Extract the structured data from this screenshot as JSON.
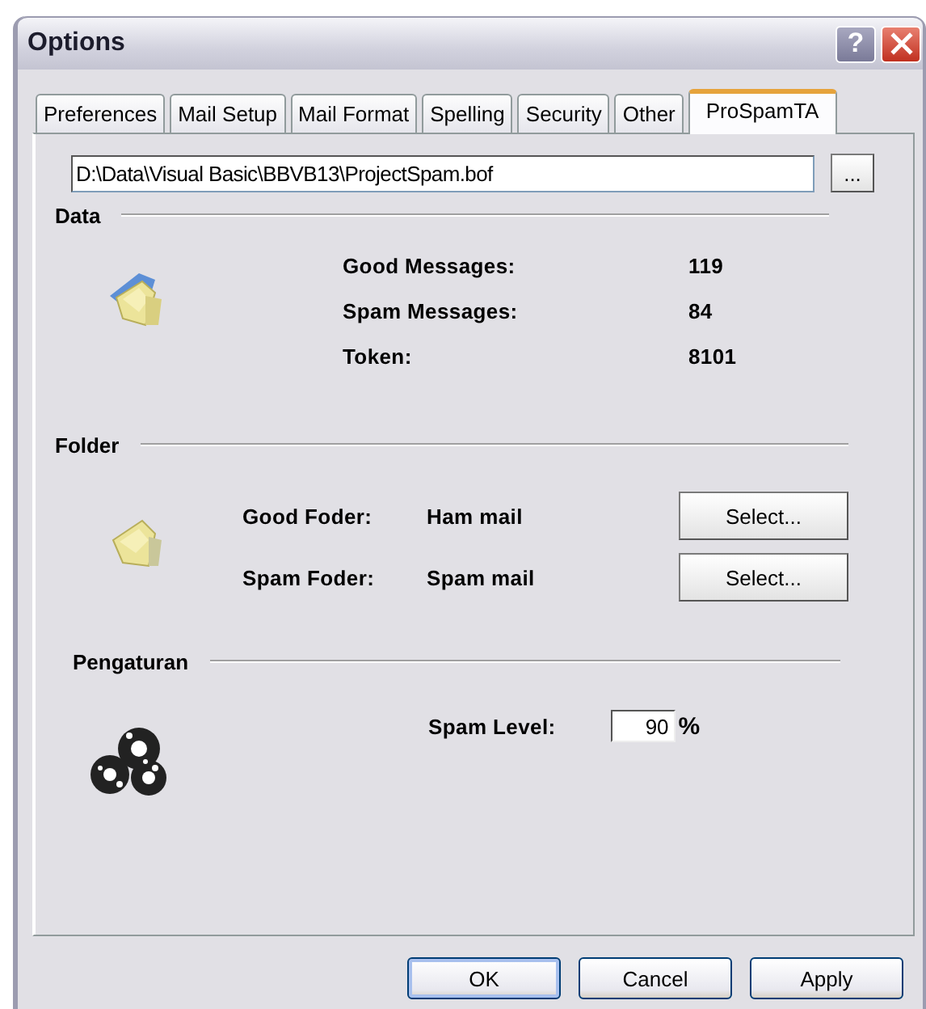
{
  "window": {
    "title": "Options",
    "help_button": "?"
  },
  "tabs": [
    {
      "label": "Preferences",
      "selected": false
    },
    {
      "label": "Mail Setup",
      "selected": false
    },
    {
      "label": "Mail Format",
      "selected": false
    },
    {
      "label": "Spelling",
      "selected": false
    },
    {
      "label": "Security",
      "selected": false
    },
    {
      "label": "Other",
      "selected": false
    },
    {
      "label": "ProSpamTA",
      "selected": true
    }
  ],
  "file_path": {
    "value": "D:\\Data\\Visual Basic\\BBVB13\\ProjectSpam.bof",
    "browse_button": "..."
  },
  "data": {
    "heading": "Data",
    "stats": [
      {
        "label": "Good Messages:",
        "value": "119"
      },
      {
        "label": "Spam Messages:",
        "value": "84"
      },
      {
        "label": "Token:",
        "value": "8101"
      }
    ]
  },
  "folder": {
    "heading": "Folder",
    "rows": [
      {
        "label": "Good Foder:",
        "value": "Ham mail",
        "button": "Select..."
      },
      {
        "label": "Spam Foder:",
        "value": "Spam mail",
        "button": "Select..."
      }
    ]
  },
  "settings": {
    "heading": "Pengaturan",
    "spam_level": {
      "label": "Spam Level:",
      "value": "90",
      "unit": "%"
    }
  },
  "buttons": [
    {
      "label": "OK",
      "default": true
    },
    {
      "label": "Cancel",
      "default": false
    },
    {
      "label": "Apply",
      "default": false
    }
  ]
}
